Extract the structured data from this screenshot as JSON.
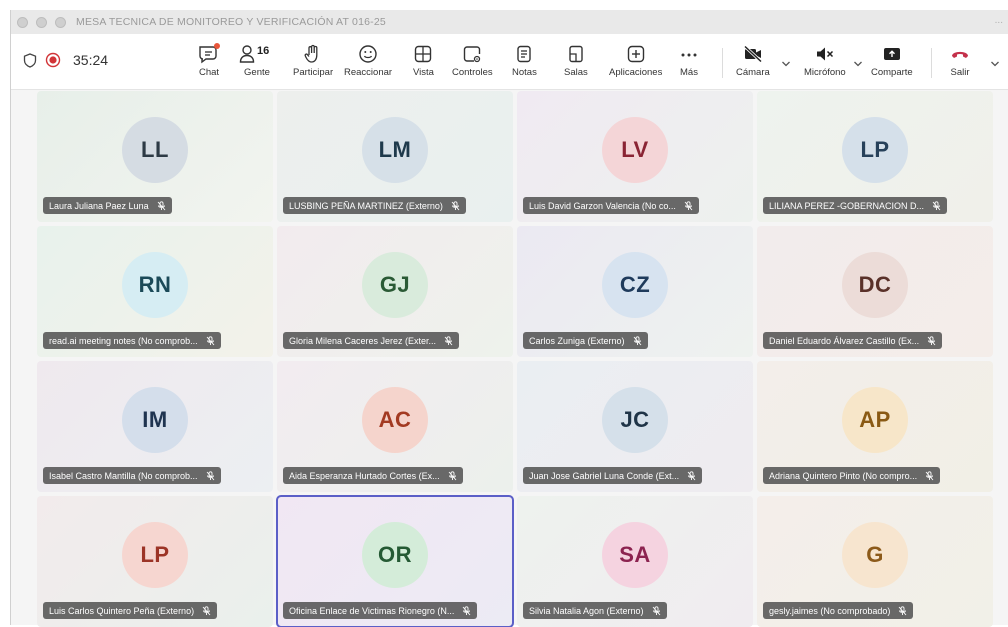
{
  "window": {
    "title": "MESA TECNICA DE MONITOREO Y VERIFICACIÓN AT 016-25",
    "more": "..."
  },
  "toolbar": {
    "timer": "35:24",
    "people_count": "16",
    "items": {
      "chat": "Chat",
      "people": "Gente",
      "raise": "Participar",
      "react": "Reaccionar",
      "view": "Vista",
      "controls": "Controles",
      "notes": "Notas",
      "rooms": "Salas",
      "apps": "Aplicaciones",
      "more": "Más",
      "camera": "Cámara",
      "mic": "Micrófono",
      "share": "Comparte",
      "leave": "Salir"
    },
    "colors": {
      "record": "#d13438",
      "leave": "#c4314b",
      "notif": "#e8563a"
    }
  },
  "participants": [
    {
      "initials": "LL",
      "name": "Laura Juliana Paez Luna",
      "avatar_bg": "#d5dce3",
      "avatar_fg": "#2d3a45",
      "tile_bg": "linear-gradient(135deg,#e7efe9,#f2f4ef)"
    },
    {
      "initials": "LM",
      "name": "LUSBING PEÑA MARTINEZ (Externo)",
      "avatar_bg": "#d6e0e8",
      "avatar_fg": "#1f3a4c",
      "tile_bg": "linear-gradient(135deg,#edefed,#e9f0ef)"
    },
    {
      "initials": "LV",
      "name": "Luis David Garzon Valencia (No co...",
      "avatar_bg": "#f4d5d7",
      "avatar_fg": "#8a2434",
      "tile_bg": "linear-gradient(135deg,#f0eaf2,#edf1ee)"
    },
    {
      "initials": "LP",
      "name": "LILIANA PEREZ -GOBERNACION D...",
      "avatar_bg": "#d5e0ea",
      "avatar_fg": "#27415a",
      "tile_bg": "linear-gradient(135deg,#eef3ee,#f0f0ea)"
    },
    {
      "initials": "RN",
      "name": "read.ai meeting notes (No comprob...",
      "avatar_bg": "#d6edf3",
      "avatar_fg": "#1b4a58",
      "tile_bg": "linear-gradient(135deg,#e8f2ec,#f3f2ea)"
    },
    {
      "initials": "GJ",
      "name": "Gloria Milena Caceres Jerez (Exter...",
      "avatar_bg": "#d9ebdc",
      "avatar_fg": "#2a5a35",
      "tile_bg": "linear-gradient(135deg,#f2ebee,#eef2ec)"
    },
    {
      "initials": "CZ",
      "name": "Carlos Zuniga (Externo)",
      "avatar_bg": "#d7e3f0",
      "avatar_fg": "#1f3b5c",
      "tile_bg": "linear-gradient(135deg,#ebe9f2,#eef2ef)"
    },
    {
      "initials": "DC",
      "name": "Daniel Eduardo Álvarez Castillo (Ex...",
      "avatar_bg": "#ecdcd8",
      "avatar_fg": "#5a3129",
      "tile_bg": "linear-gradient(135deg,#f2ecec,#f4ede9)"
    },
    {
      "initials": "IM",
      "name": "Isabel Castro Mantilla (No comprob...",
      "avatar_bg": "#d4deeb",
      "avatar_fg": "#1f3450",
      "tile_bg": "linear-gradient(135deg,#efe9ee,#eceff2)"
    },
    {
      "initials": "AC",
      "name": "Aida Esperanza Hurtado Cortes (Ex...",
      "avatar_bg": "#f5d4cc",
      "avatar_fg": "#a33a22",
      "tile_bg": "linear-gradient(135deg,#f2ecf0,#ecf0ec)"
    },
    {
      "initials": "JC",
      "name": "Juan Jose Gabriel Luna Conde (Ext...",
      "avatar_bg": "#d5e0ea",
      "avatar_fg": "#1f3447",
      "tile_bg": "linear-gradient(135deg,#eaeef2,#efecf0)"
    },
    {
      "initials": "AP",
      "name": "Adriana Quintero Pinto (No compro...",
      "avatar_bg": "#f7e6c9",
      "avatar_fg": "#8a5a14",
      "tile_bg": "linear-gradient(135deg,#f3eeea,#f1efe6)"
    },
    {
      "initials": "LP",
      "name": "Luis Carlos Quintero Peña (Externo)",
      "avatar_bg": "#f6d6d0",
      "avatar_fg": "#9c3426",
      "tile_bg": "linear-gradient(135deg,#f2ebec,#eaf0ec)"
    },
    {
      "initials": "OR",
      "name": "Oficina Enlace de Victimas Rionegro (N...",
      "avatar_bg": "#d4ecd9",
      "avatar_fg": "#255a34",
      "tile_bg": "linear-gradient(135deg,#f1e7f3,#ecebf4)"
    },
    {
      "initials": "SA",
      "name": "Silvia Natalia Agon (Externo)",
      "avatar_bg": "#f5d3e0",
      "avatar_fg": "#8c2350",
      "tile_bg": "linear-gradient(135deg,#eef2ee,#f0ecf0)"
    },
    {
      "initials": "G",
      "name": "gesly.jaimes (No comprobado)",
      "avatar_bg": "#f7e5cf",
      "avatar_fg": "#8c5a1a",
      "tile_bg": "linear-gradient(135deg,#f4eeea,#f1f0e8)"
    }
  ]
}
